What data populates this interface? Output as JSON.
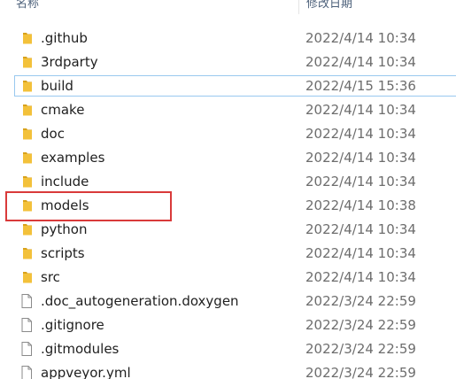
{
  "header": {
    "name_label": "名称",
    "date_label": "修改日期"
  },
  "files": [
    {
      "name": ".github",
      "date": "2022/4/14 10:34",
      "type": "folder"
    },
    {
      "name": "3rdparty",
      "date": "2022/4/14 10:34",
      "type": "folder"
    },
    {
      "name": "build",
      "date": "2022/4/15 15:36",
      "type": "folder",
      "selected": true
    },
    {
      "name": "cmake",
      "date": "2022/4/14 10:34",
      "type": "folder"
    },
    {
      "name": "doc",
      "date": "2022/4/14 10:34",
      "type": "folder"
    },
    {
      "name": "examples",
      "date": "2022/4/14 10:34",
      "type": "folder"
    },
    {
      "name": "include",
      "date": "2022/4/14 10:34",
      "type": "folder"
    },
    {
      "name": "models",
      "date": "2022/4/14 10:38",
      "type": "folder",
      "highlighted": true
    },
    {
      "name": "python",
      "date": "2022/4/14 10:34",
      "type": "folder"
    },
    {
      "name": "scripts",
      "date": "2022/4/14 10:34",
      "type": "folder"
    },
    {
      "name": "src",
      "date": "2022/4/14 10:34",
      "type": "folder"
    },
    {
      "name": ".doc_autogeneration.doxygen",
      "date": "2022/3/24 22:59",
      "type": "file"
    },
    {
      "name": ".gitignore",
      "date": "2022/3/24 22:59",
      "type": "file"
    },
    {
      "name": ".gitmodules",
      "date": "2022/3/24 22:59",
      "type": "file"
    },
    {
      "name": "appveyor.yml",
      "date": "2022/3/24 22:59",
      "type": "file"
    }
  ],
  "colors": {
    "folder": "#f3c13a",
    "folder_dark": "#d9a21b",
    "highlight": "#d93a3a",
    "selection": "#99c9ef"
  }
}
